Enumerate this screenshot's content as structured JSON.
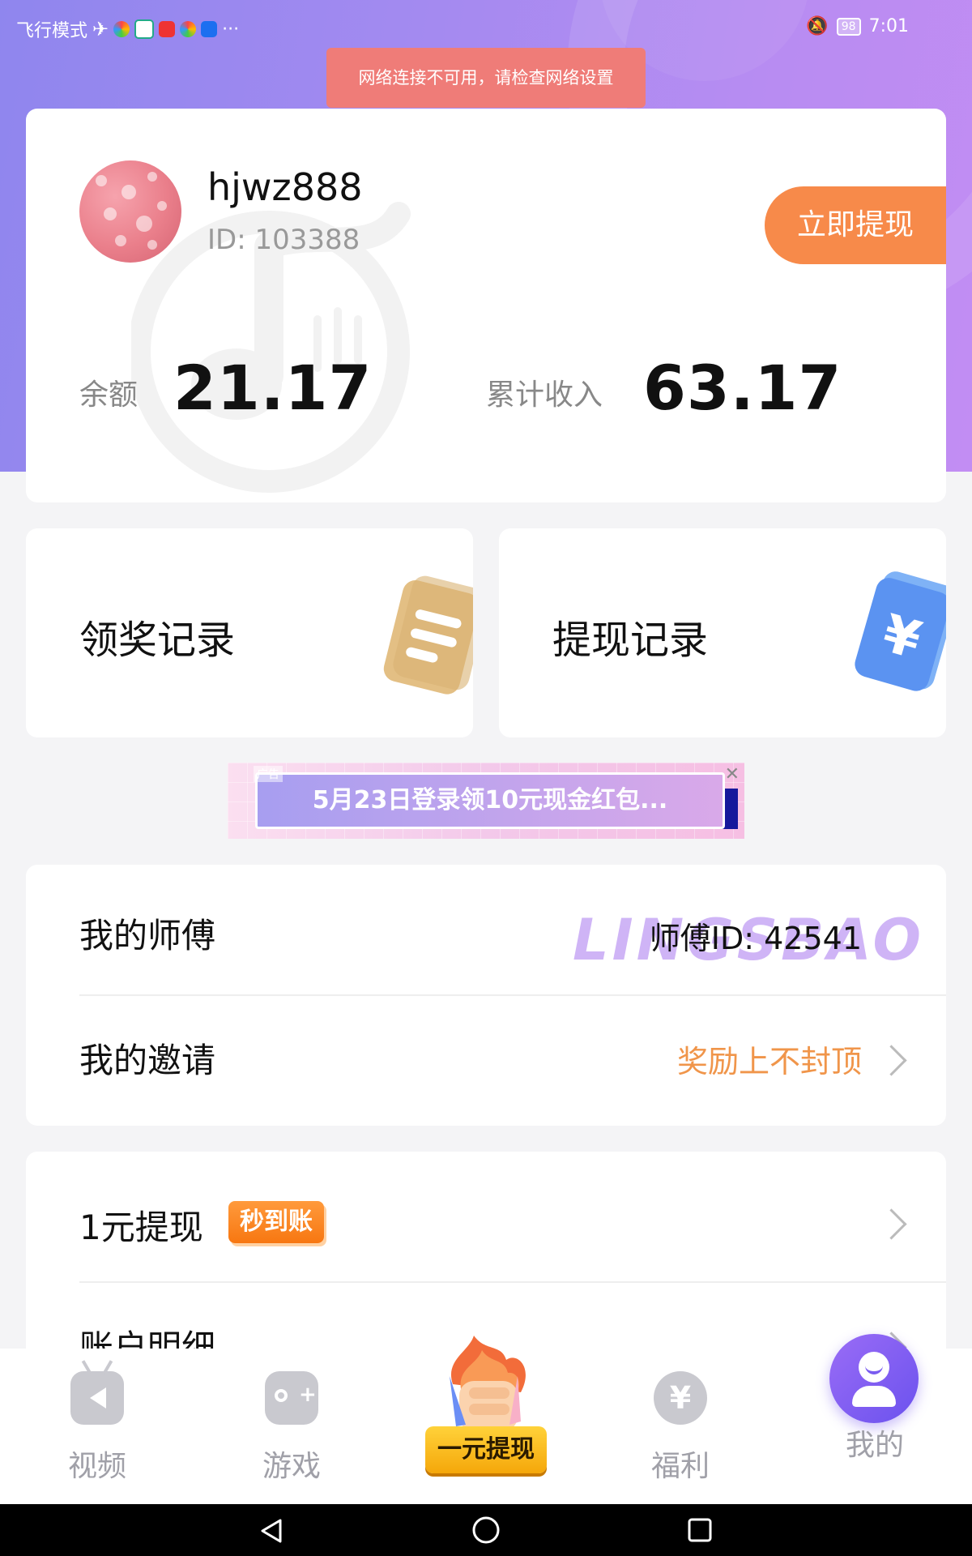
{
  "status_bar": {
    "left_text": "飞行模式",
    "more": "···",
    "battery": "98",
    "time": "7:01"
  },
  "toast": "网络连接不可用，请检查网络设置",
  "profile": {
    "username": "hjwz888",
    "user_id": "ID: 103388",
    "withdraw_button": "立即提现",
    "balance_label": "余额",
    "balance_value": "21.17",
    "total_income_label": "累计收入",
    "total_income_value": "63.17"
  },
  "records": {
    "reward_records": "领奖记录",
    "withdraw_records": "提现记录"
  },
  "ad_banner": {
    "tag": "广告",
    "text": "5月23日登录领10元现金红包..."
  },
  "invite_card": {
    "master_label": "我的师傅",
    "master_watermark": "LINGSBAO",
    "master_value": "师傅ID: 42541",
    "invite_label": "我的邀请",
    "invite_value": "奖励上不封顶"
  },
  "account_card": {
    "one_yuan_label": "1元提现",
    "one_yuan_badge": "秒到账",
    "details_label": "账户明细"
  },
  "bottom_nav": {
    "video": "视频",
    "games": "游戏",
    "center": "一元提现",
    "welfare": "福利",
    "mine": "我的"
  },
  "colors": {
    "hero_gradient_start": "#8f86ee",
    "hero_gradient_end": "#c28df3",
    "accent_orange": "#f78a4a",
    "invite_orange": "#f0954a",
    "toast_red": "#ef7c78"
  }
}
